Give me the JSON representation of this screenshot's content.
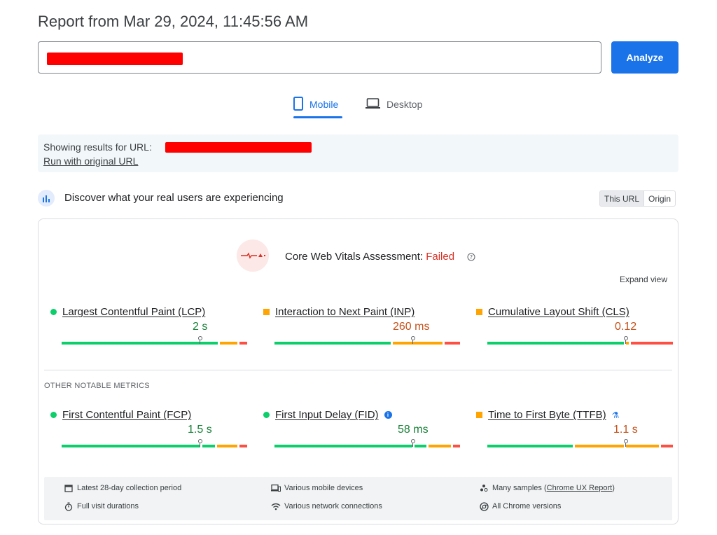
{
  "header": {
    "title": "Report from Mar 29, 2024, 11:45:56 AM"
  },
  "search": {
    "value": "",
    "button": "Analyze"
  },
  "tabs": [
    {
      "label": "Mobile",
      "icon": "smartphone-icon",
      "active": true
    },
    {
      "label": "Desktop",
      "icon": "laptop-icon",
      "active": false
    }
  ],
  "url_info": {
    "label": "Showing results for URL:",
    "link": "Run with original URL"
  },
  "discover": {
    "text": "Discover what your real users are experiencing",
    "toggle": [
      "This URL",
      "Origin"
    ]
  },
  "assessment": {
    "label": "Core Web Vitals Assessment:",
    "status": "Failed",
    "expand": "Expand view"
  },
  "core_metrics": [
    {
      "name": "Largest Contentful Paint (LCP)",
      "value": "2 s",
      "rating": "good"
    },
    {
      "name": "Interaction to Next Paint (INP)",
      "value": "260 ms",
      "rating": "needs-improvement"
    },
    {
      "name": "Cumulative Layout Shift (CLS)",
      "value": "0.12",
      "rating": "needs-improvement"
    }
  ],
  "other_heading": "OTHER NOTABLE METRICS",
  "other_metrics": [
    {
      "name": "First Contentful Paint (FCP)",
      "value": "1.5 s",
      "rating": "good"
    },
    {
      "name": "First Input Delay (FID)",
      "value": "58 ms",
      "rating": "good"
    },
    {
      "name": "Time to First Byte (TTFB)",
      "value": "1.1 s",
      "rating": "needs-improvement"
    }
  ],
  "footer": {
    "period": "Latest 28-day collection period",
    "devices": "Various mobile devices",
    "samples_prefix": "Many samples (",
    "samples_link": "Chrome UX Report",
    "samples_suffix": ")",
    "durations": "Full visit durations",
    "network": "Various network connections",
    "chrome": "All Chrome versions"
  },
  "colors": {
    "good": "#0cce6b",
    "average": "#ffa400",
    "poor": "#ff4e42",
    "accent": "#1a73e8",
    "failed": "#d93025"
  }
}
